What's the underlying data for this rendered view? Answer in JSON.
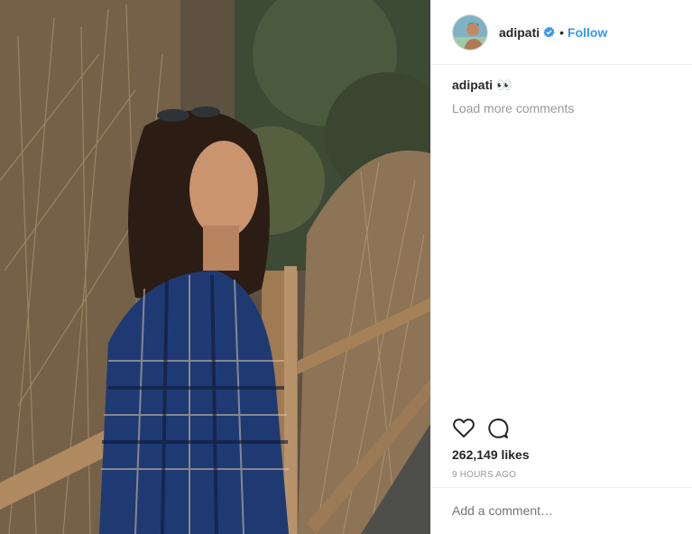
{
  "post": {
    "photo_alt": "",
    "header": {
      "username": "adipati",
      "separator": "•",
      "follow_label": "Follow",
      "verified_icon": "verified-badge-icon"
    },
    "caption": {
      "username": "adipati",
      "text": "👀"
    },
    "load_more_label": "Load more comments",
    "actions": {
      "like_icon": "heart-icon",
      "comment_icon": "comment-icon"
    },
    "likes_text": "262,149 likes",
    "timestamp": "9 HOURS AGO",
    "comment_placeholder": "Add a comment…",
    "colors": {
      "link": "#3897f0",
      "muted": "#999999",
      "text": "#262626",
      "border": "#efefef"
    }
  }
}
